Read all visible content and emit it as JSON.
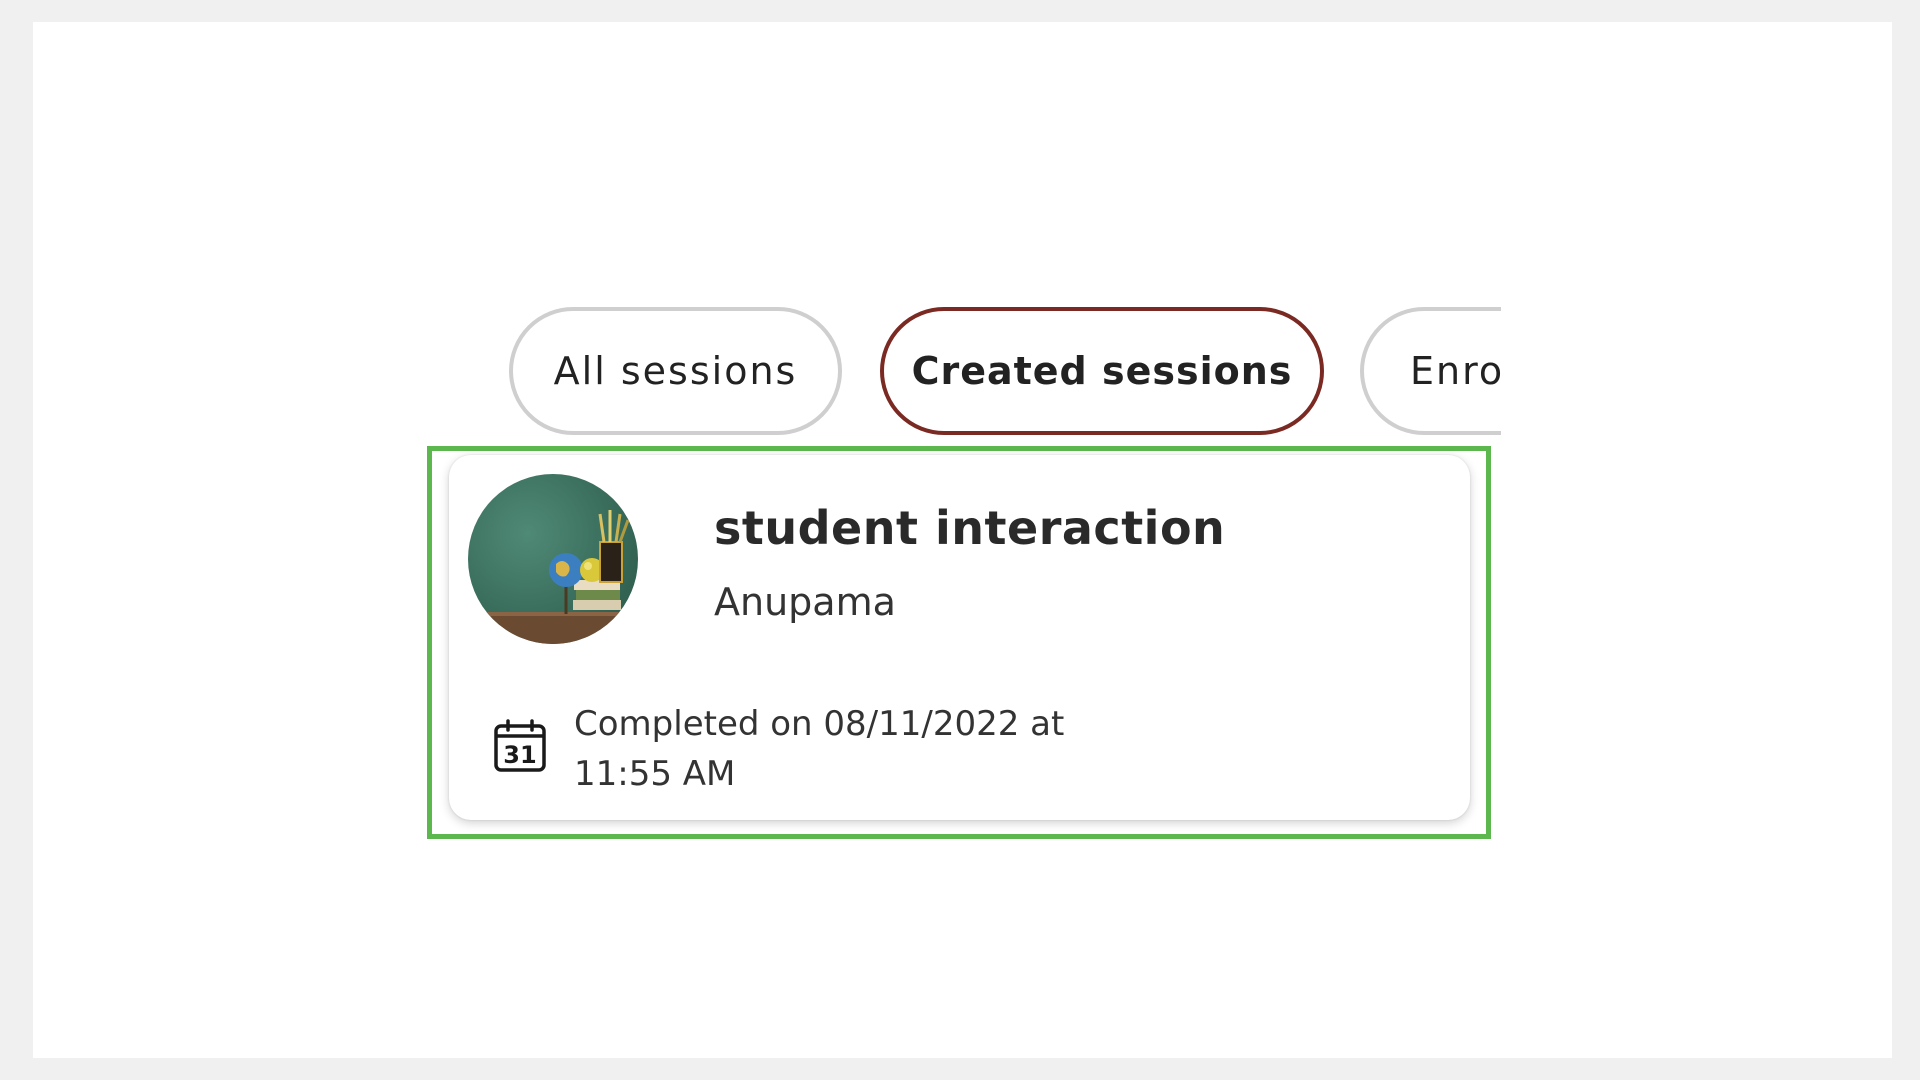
{
  "tabs": [
    {
      "label": "All sessions",
      "selected": false
    },
    {
      "label": "Created sessions",
      "selected": true
    },
    {
      "label": "Enrolled sessions",
      "selected": false,
      "visible_text": "Enro"
    }
  ],
  "session_card": {
    "title": "student interaction",
    "host": "Anupama",
    "status": "Completed on 08/11/2022 at 11:55 AM",
    "calendar_icon_day": "31",
    "thumbnail_icon": "classroom-globe-books-image"
  },
  "colors": {
    "selected_tab_border": "#7a2a22",
    "tab_border": "#cfcfcf",
    "highlight_border": "#5cb84e"
  }
}
